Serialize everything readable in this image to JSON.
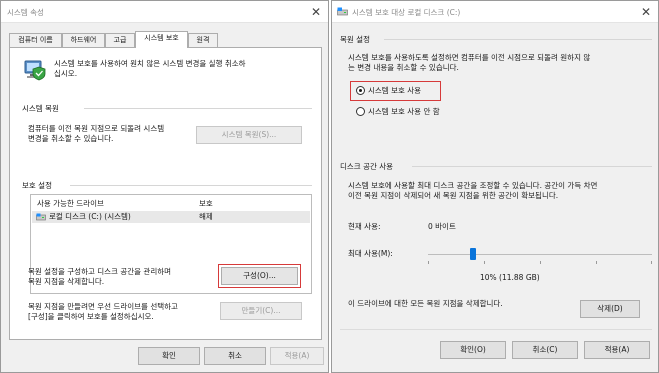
{
  "left_dialog": {
    "title": "시스템 속성",
    "tabs": [
      "컴퓨터 이름",
      "하드웨어",
      "고급",
      "시스템 보호",
      "원격"
    ],
    "active_tab_index": 3,
    "intro_text": [
      "시스템 보호를 사용하여 원치 않은 시스템 변경을 실행 취소하",
      "십시오."
    ],
    "restore_section": {
      "title": "시스템 복원",
      "desc": [
        "컴퓨터를 이전 복원 지점으로 되돌려 시스템",
        "변경을 취소할 수 있습니다."
      ],
      "button": "시스템 복원(S)..."
    },
    "protection_section": {
      "title": "보호 설정",
      "col_drive": "사용 가능한 드라이브",
      "col_protection": "보호",
      "drives": [
        {
          "name": "로컬 디스크 (C:) (시스템)",
          "status": "해제"
        }
      ],
      "configure_desc": [
        "복원 설정을 구성하고 디스크 공간을 관리하며",
        "복원 지점을 삭제합니다."
      ],
      "configure_button": "구성(O)...",
      "create_desc": [
        "복원 지점을 만들려면 우선 드라이브를 선택하고",
        "[구성]을 클릭하여 보호를 설정하십시오."
      ],
      "create_button": "만들기(C)..."
    },
    "footer": {
      "ok": "확인",
      "cancel": "취소",
      "apply": "적용(A)"
    }
  },
  "right_dialog": {
    "title": "시스템 보호 대상 로컬 디스크 (C:)",
    "restore_settings": {
      "title": "복원 설정",
      "desc": [
        "시스템 보호를 사용하도록 설정하면 컴퓨터를 이전 시점으로 되돌려 원하지 않",
        "는 변경 내용을 취소할 수 있습니다."
      ],
      "options": [
        {
          "label": "시스템 보호 사용",
          "checked": true
        },
        {
          "label": "시스템 보호 사용 안 함",
          "checked": false
        }
      ]
    },
    "disk_usage": {
      "title": "디스크 공간 사용",
      "desc": [
        "시스템 보호에 사용할 최대 디스크 공간을 조정할 수 있습니다. 공간이 가득 차면",
        "이전 복원 지점이 삭제되어 새 복원 지점을 위한 공간이 확보됩니다."
      ],
      "current_label": "현재 사용:",
      "current_value": "0 바이트",
      "max_label": "최대 사용(M):",
      "max_fraction": 0.1,
      "max_value": "10% (11.88 GB)",
      "delete_desc": "이 드라이브에 대한 모든 복원 지점을 삭제합니다.",
      "delete_button": "삭제(D)"
    },
    "footer": {
      "ok": "확인(O)",
      "cancel": "취소(C)",
      "apply": "적용(A)"
    }
  }
}
